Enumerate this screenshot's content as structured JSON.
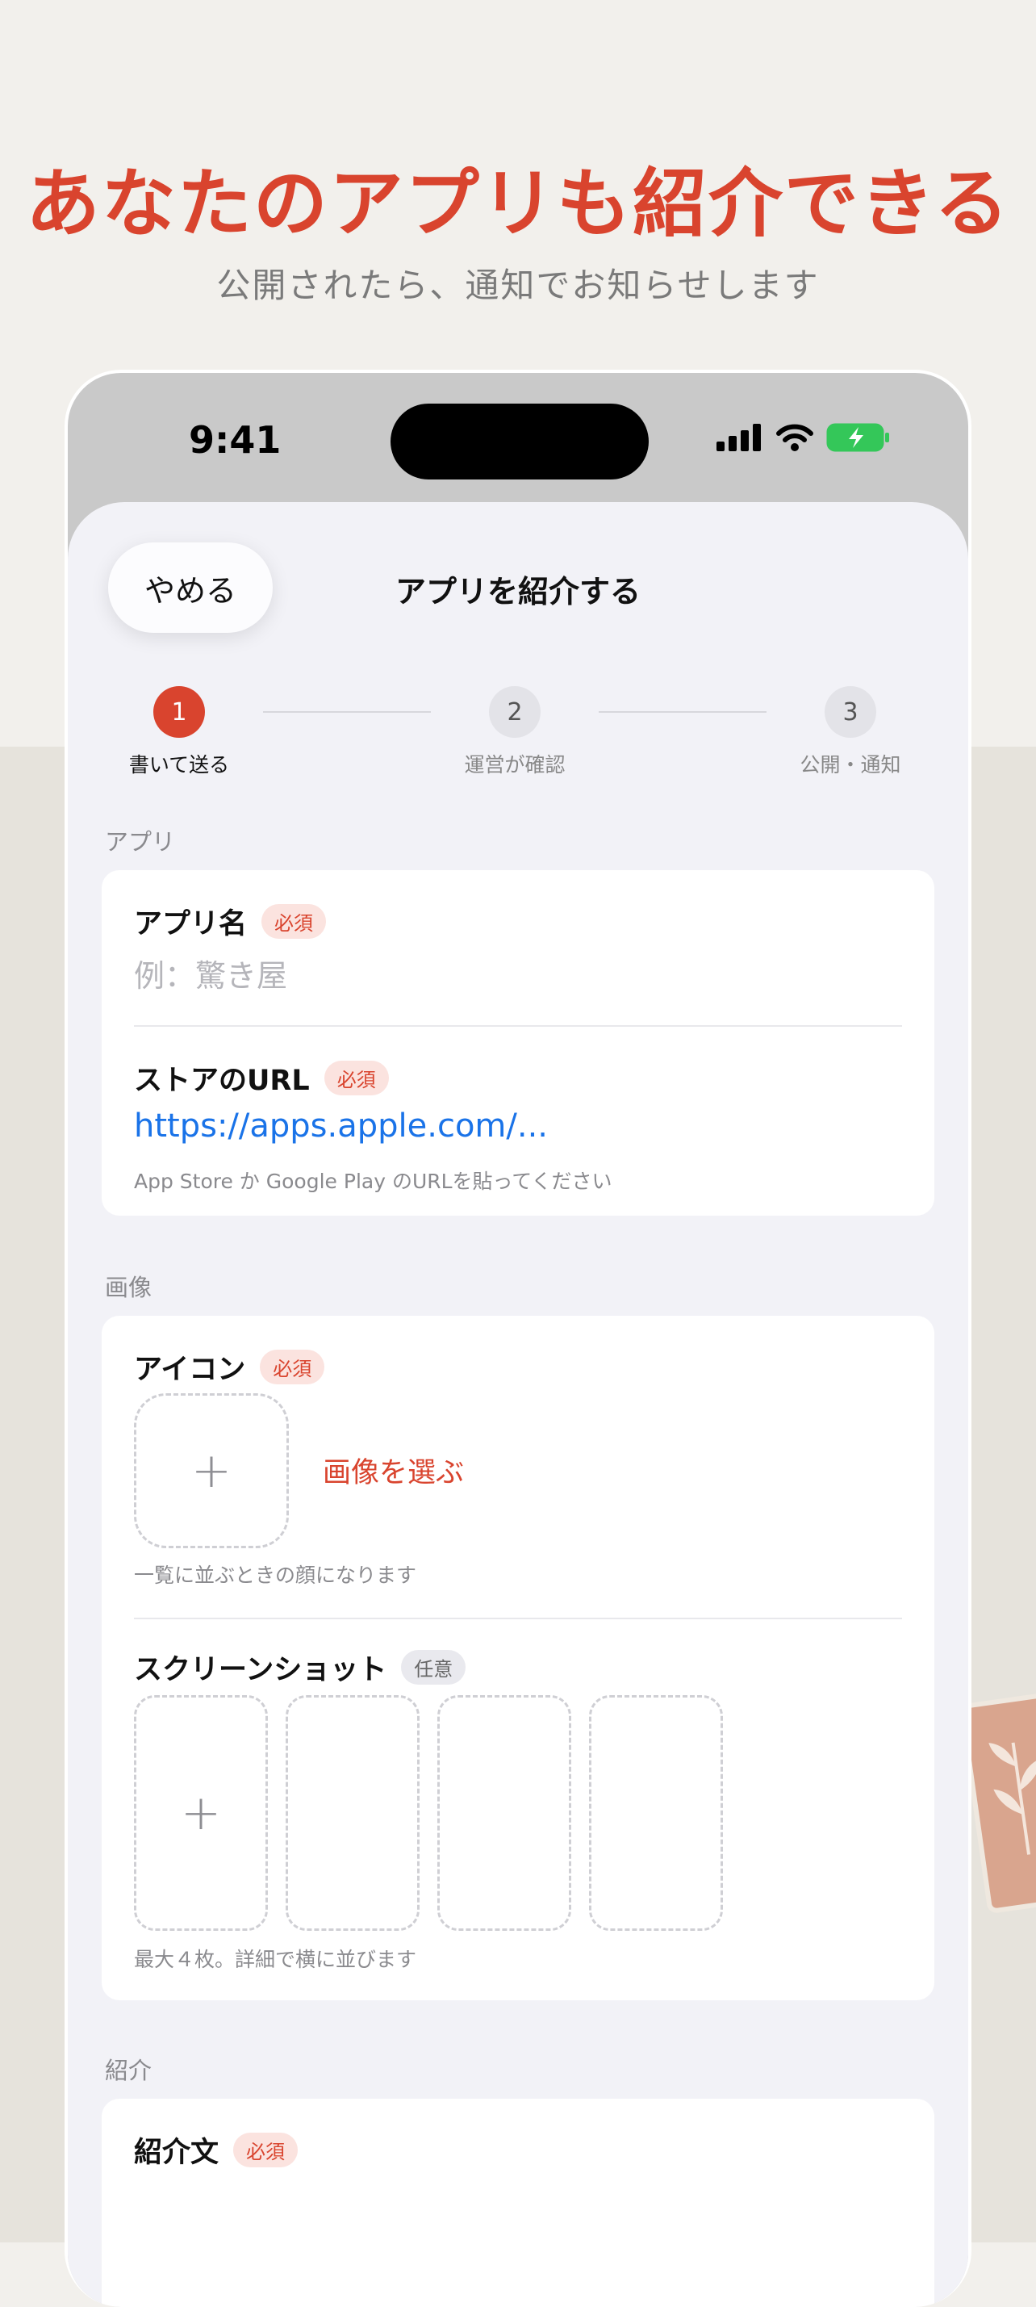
{
  "promo": {
    "headline": "あなたのアプリも紹介できる",
    "subhead": "公開されたら、通知でお知らせします"
  },
  "status_bar": {
    "time": "9:41"
  },
  "sheet": {
    "cancel_label": "やめる",
    "title": "アプリを紹介する"
  },
  "steps": [
    {
      "number": "1",
      "label": "書いて送る",
      "active": true
    },
    {
      "number": "2",
      "label": "運営が確認",
      "active": false
    },
    {
      "number": "3",
      "label": "公開・通知",
      "active": false
    }
  ],
  "sections": {
    "app": "アプリ",
    "image": "画像",
    "intro": "紹介"
  },
  "fields": {
    "app_name": {
      "label": "アプリ名",
      "badge": "必須",
      "placeholder": "例：驚き屋"
    },
    "store_url": {
      "label": "ストアのURL",
      "badge": "必須",
      "value": "https://apps.apple.com/...",
      "hint": "App Store か Google Play のURLを貼ってください"
    },
    "icon": {
      "label": "アイコン",
      "badge": "必須",
      "choose_label": "画像を選ぶ",
      "add_glyph": "+",
      "hint": "一覧に並ぶときの顔になります"
    },
    "screenshots": {
      "label": "スクリーンショット",
      "badge": "任意",
      "add_glyph": "+",
      "hint": "最大４枚。詳細で横に並びます"
    },
    "intro_text": {
      "label": "紹介文",
      "badge": "必須"
    }
  },
  "colors": {
    "accent": "#d9442e",
    "link": "#1a73e8",
    "background": "#f2f0ec",
    "sheet": "#f2f2f7"
  }
}
